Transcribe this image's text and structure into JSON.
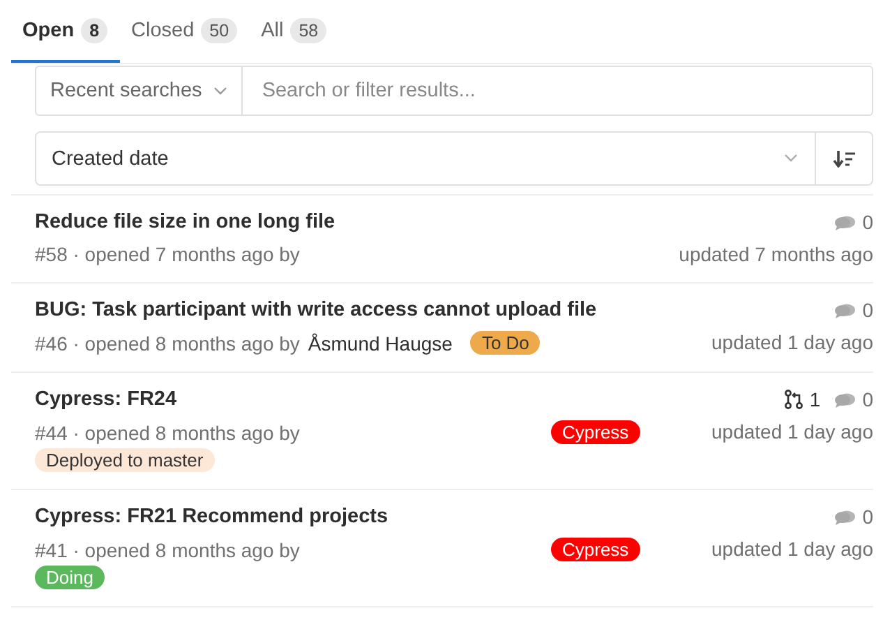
{
  "tabs": [
    {
      "label": "Open",
      "count": "8",
      "selected": true
    },
    {
      "label": "Closed",
      "count": "50",
      "selected": false
    },
    {
      "label": "All",
      "count": "58",
      "selected": false
    }
  ],
  "filter": {
    "recent": "Recent searches",
    "placeholder": "Search or filter results..."
  },
  "sort": {
    "value": "Created date"
  },
  "issues": [
    {
      "title": "Reduce file size in one long file",
      "meta": "#58 · opened 7 months ago by",
      "comments": "0",
      "updated": "updated 7 months ago"
    },
    {
      "title": "BUG: Task participant with write access cannot upload file",
      "meta": "#46 · opened 8 months ago by",
      "author": "Åsmund Haugse",
      "labels": [
        {
          "text": "To Do",
          "color": "#eda94a"
        }
      ],
      "comments": "0",
      "updated": "updated 1 day ago"
    },
    {
      "title": "Cypress: FR24",
      "meta": "#44 · opened 8 months ago by",
      "side_labels": [
        {
          "text": "Cypress",
          "color": "#ff0000"
        }
      ],
      "bottom_labels": [
        {
          "text": "Deployed to master",
          "color": "#fde8d8"
        }
      ],
      "merge_requests": "1",
      "comments": "0",
      "updated": "updated 1 day ago"
    },
    {
      "title": "Cypress: FR21 Recommend projects",
      "meta": "#41 · opened 8 months ago by",
      "side_labels": [
        {
          "text": "Cypress",
          "color": "#ff0000"
        }
      ],
      "bottom_labels": [
        {
          "text": "Doing",
          "color": "#5cb85c"
        }
      ],
      "comments": "0",
      "updated": "updated 1 day ago"
    }
  ]
}
